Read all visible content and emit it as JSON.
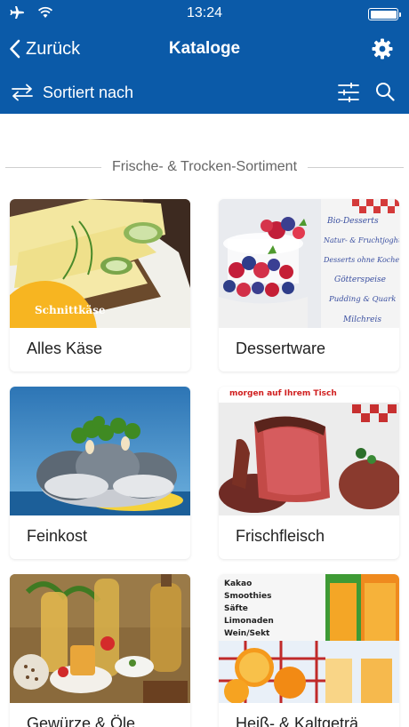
{
  "status": {
    "time": "13:24"
  },
  "nav": {
    "back_label": "Zurück",
    "title": "Kataloge"
  },
  "sortbar": {
    "label": "Sortiert nach"
  },
  "section": {
    "title": "Frische- & Trocken-Sortiment"
  },
  "catalogs": [
    {
      "label": "Alles Käse",
      "image_text": "Schnittkäse"
    },
    {
      "label": "Dessertware",
      "image_lines": [
        "Bio-Desserts",
        "Natur- & Fruchtjoghurt",
        "Desserts ohne Kochen",
        "Götterspeise",
        "Pudding & Quark",
        "Milchreis"
      ]
    },
    {
      "label": "Feinkost"
    },
    {
      "label": "Frischfleisch",
      "image_text": "morgen auf Ihrem Tisch"
    },
    {
      "label": "Gewürze & Öle"
    },
    {
      "label": "Heiß- & Kaltgeträ",
      "image_lines": [
        "Kakao",
        "Smoothies",
        "Säfte",
        "Limonaden",
        "Wein/Sekt"
      ]
    }
  ],
  "colors": {
    "primary": "#0b5aa8",
    "white": "#ffffff"
  }
}
